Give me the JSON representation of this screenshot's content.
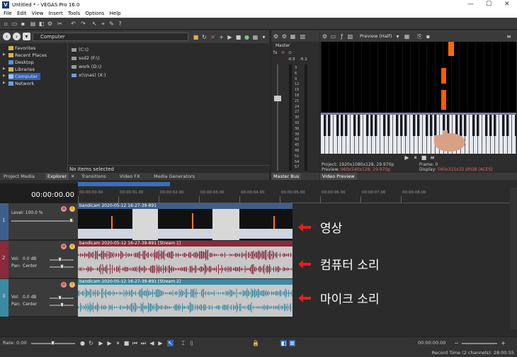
{
  "app": {
    "title": "Untitled * - VEGAS Pro 16.0",
    "logo_letter": "V",
    "window_controls": [
      "—",
      "☐",
      "✕"
    ]
  },
  "menu": [
    "File",
    "Edit",
    "View",
    "Insert",
    "Tools",
    "Options",
    "Help"
  ],
  "explorer": {
    "path": "Computer",
    "tree": [
      {
        "label": "Favorites",
        "expandable": false
      },
      {
        "label": "Recent Places",
        "expandable": true
      },
      {
        "label": "Desktop",
        "expandable": false
      },
      {
        "label": "Libraries",
        "expandable": true
      },
      {
        "label": "Computer",
        "expandable": true,
        "selected": true
      },
      {
        "label": "Network",
        "expandable": true
      }
    ],
    "drives": [
      "(C:\\)",
      "ssd2 (F:\\)",
      "work (D:\\)",
      "x(\\\\nas) (X:)"
    ],
    "no_items": "No items selected"
  },
  "tabs_left": [
    "Project Media",
    "Explorer",
    "Transitions",
    "Video FX",
    "Media Generators"
  ],
  "active_tab": "Explorer",
  "master": {
    "label": "Master",
    "peak_left": "-0.5",
    "peak_right": "-5.1",
    "scale": [
      "3",
      "6",
      "9",
      "12",
      "15",
      "18",
      "21",
      "24",
      "27",
      "30",
      "33",
      "36",
      "39",
      "42",
      "45",
      "48",
      "51",
      "54",
      "57"
    ],
    "tab": "Master Bus"
  },
  "preview": {
    "quality": "Preview (Half)",
    "tab": "Video Preview",
    "project_label": "Project:",
    "project_value": "1920x1080x128, 29.970p",
    "preview_label": "Preview:",
    "preview_value": "960x540x128, 29.970p",
    "frame_label": "Frame:",
    "frame_value": "0",
    "display_label": "Display:",
    "display_value": "560x315x32 sRGB (ACES)"
  },
  "timeline": {
    "timecode": "00:00:00.00",
    "ruler": [
      "00:00:00.00",
      "00:00:01.00",
      "00:00:02.00",
      "00:00:03.00",
      "00:00:04.00",
      "00:00:05.00",
      "00:00:06.00",
      "00:00:07.00",
      "00:00:08.00"
    ],
    "tracks": [
      {
        "number": "1",
        "type": "video",
        "level": "Level: 100.0 %",
        "event": "bandicam 2020-05-12 16-27-39-891",
        "annotation": "영상"
      },
      {
        "number": "2",
        "type": "audio",
        "vol_label": "Vol:",
        "vol_value": "0.0 dB",
        "pan_label": "Pan:",
        "pan_value": "Center",
        "event": "bandicam 2020-05-12 16-27-39-891 [Stream 1]",
        "annotation": "컴퓨터 소리"
      },
      {
        "number": "3",
        "type": "audio",
        "vol_label": "Vol:",
        "vol_value": "0.0 dB",
        "pan_label": "Pan:",
        "pan_value": "Center",
        "event": "bandicam 2020-05-12 16-27-39-891 [Stream 2]",
        "annotation": "마이크 소리"
      }
    ],
    "rate": "Rate: 0.00",
    "transport_time": "00:00:00.00"
  },
  "status": {
    "record_time": "Record Time (2 channels): 28:00:55"
  },
  "colors": {
    "video_track": "#3e5f8e",
    "audio1_track": "#8a2a3a",
    "audio2_track": "#3b8aa3",
    "annotation_arrow": "#e02020",
    "selection": "#2e63b5"
  }
}
